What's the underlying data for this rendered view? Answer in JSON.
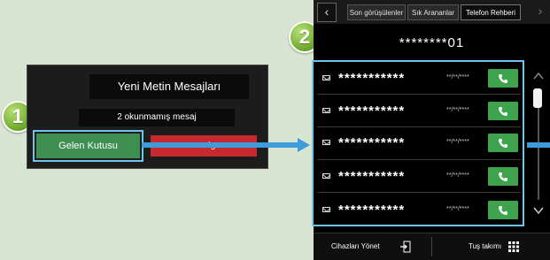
{
  "dialog": {
    "title": "Yeni Metin Mesajları",
    "unread": "2 okunmamış mesaj",
    "inbox_label": "Gelen Kutusu",
    "ignore_label": "Ignore"
  },
  "badges": [
    "1",
    "2"
  ],
  "phone": {
    "tabs": [
      "Son görüşülenler",
      "Sık Arananlar",
      "Telefon Rehberi"
    ],
    "active_tab": "Telefon Rehberi",
    "number": "********01",
    "rows": [
      {
        "masked": "***********",
        "date": "**/**/****"
      },
      {
        "masked": "***********",
        "date": "**/**/****"
      },
      {
        "masked": "***********",
        "date": "**/**/****"
      },
      {
        "masked": "***********",
        "date": "**/**/****"
      },
      {
        "masked": "***********",
        "date": "**/**/****"
      }
    ],
    "bottom": {
      "devices_label": "Cihazları Yönet",
      "keypad_label": "Tuş takımı"
    }
  },
  "colors": {
    "background": "#d8e5d3",
    "highlight": "#6fc6ea",
    "arrow": "#3f9bd9",
    "call_green": "#3fa34d",
    "inbox_green": "#3f8f52",
    "ignore_red": "#c62a2f"
  },
  "icons": [
    "back-icon",
    "forward-icon",
    "mail-icon",
    "phone-icon",
    "scroll-up-icon",
    "scroll-down-icon",
    "device-import-icon",
    "keypad-icon"
  ]
}
